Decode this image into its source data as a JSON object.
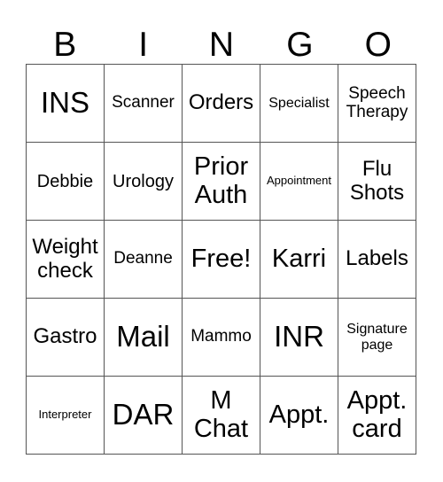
{
  "header": [
    "B",
    "I",
    "N",
    "G",
    "O"
  ],
  "rows": [
    [
      "INS",
      "Scanner",
      "Orders",
      "Specialist",
      "Speech Therapy"
    ],
    [
      "Debbie",
      "Urology",
      "Prior Auth",
      "Appointment",
      "Flu Shots"
    ],
    [
      "Weight check",
      "Deanne",
      "Free!",
      "Karri",
      "Labels"
    ],
    [
      "Gastro",
      "Mail",
      "Mammo",
      "INR",
      "Signature page"
    ],
    [
      "Interpreter",
      "DAR",
      "M Chat",
      "Appt.",
      "Appt. card"
    ]
  ]
}
